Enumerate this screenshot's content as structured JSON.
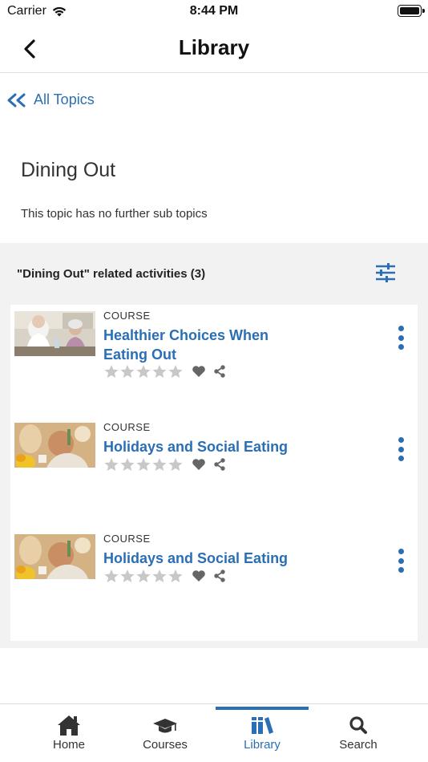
{
  "status_bar": {
    "carrier": "Carrier",
    "time": "8:44 PM"
  },
  "navbar": {
    "title": "Library",
    "back_icon": "chevron-left-icon"
  },
  "all_topics": {
    "label": "All Topics",
    "icon": "double-chevron-left-icon"
  },
  "topic": {
    "title": "Dining Out",
    "subtitle": "This topic has no further sub topics"
  },
  "activities": {
    "header": "\"Dining Out\" related activities (3)",
    "filter_icon": "sliders-icon",
    "items": [
      {
        "type": "COURSE",
        "title": "Healthier Choices When Eating Out",
        "rating": 0,
        "max_rating": 5
      },
      {
        "type": "COURSE",
        "title": "Holidays and Social Eating",
        "rating": 0,
        "max_rating": 5
      },
      {
        "type": "COURSE",
        "title": "Holidays and Social Eating",
        "rating": 0,
        "max_rating": 5
      }
    ]
  },
  "tabs": [
    {
      "label": "Home",
      "icon": "home-icon"
    },
    {
      "label": "Courses",
      "icon": "graduation-cap-icon"
    },
    {
      "label": "Library",
      "icon": "books-icon",
      "active": true
    },
    {
      "label": "Search",
      "icon": "search-icon"
    }
  ],
  "colors": {
    "accent": "#2a6fb5",
    "panel_bg": "#f2f2f2",
    "star_gray": "#c8c8c8"
  }
}
